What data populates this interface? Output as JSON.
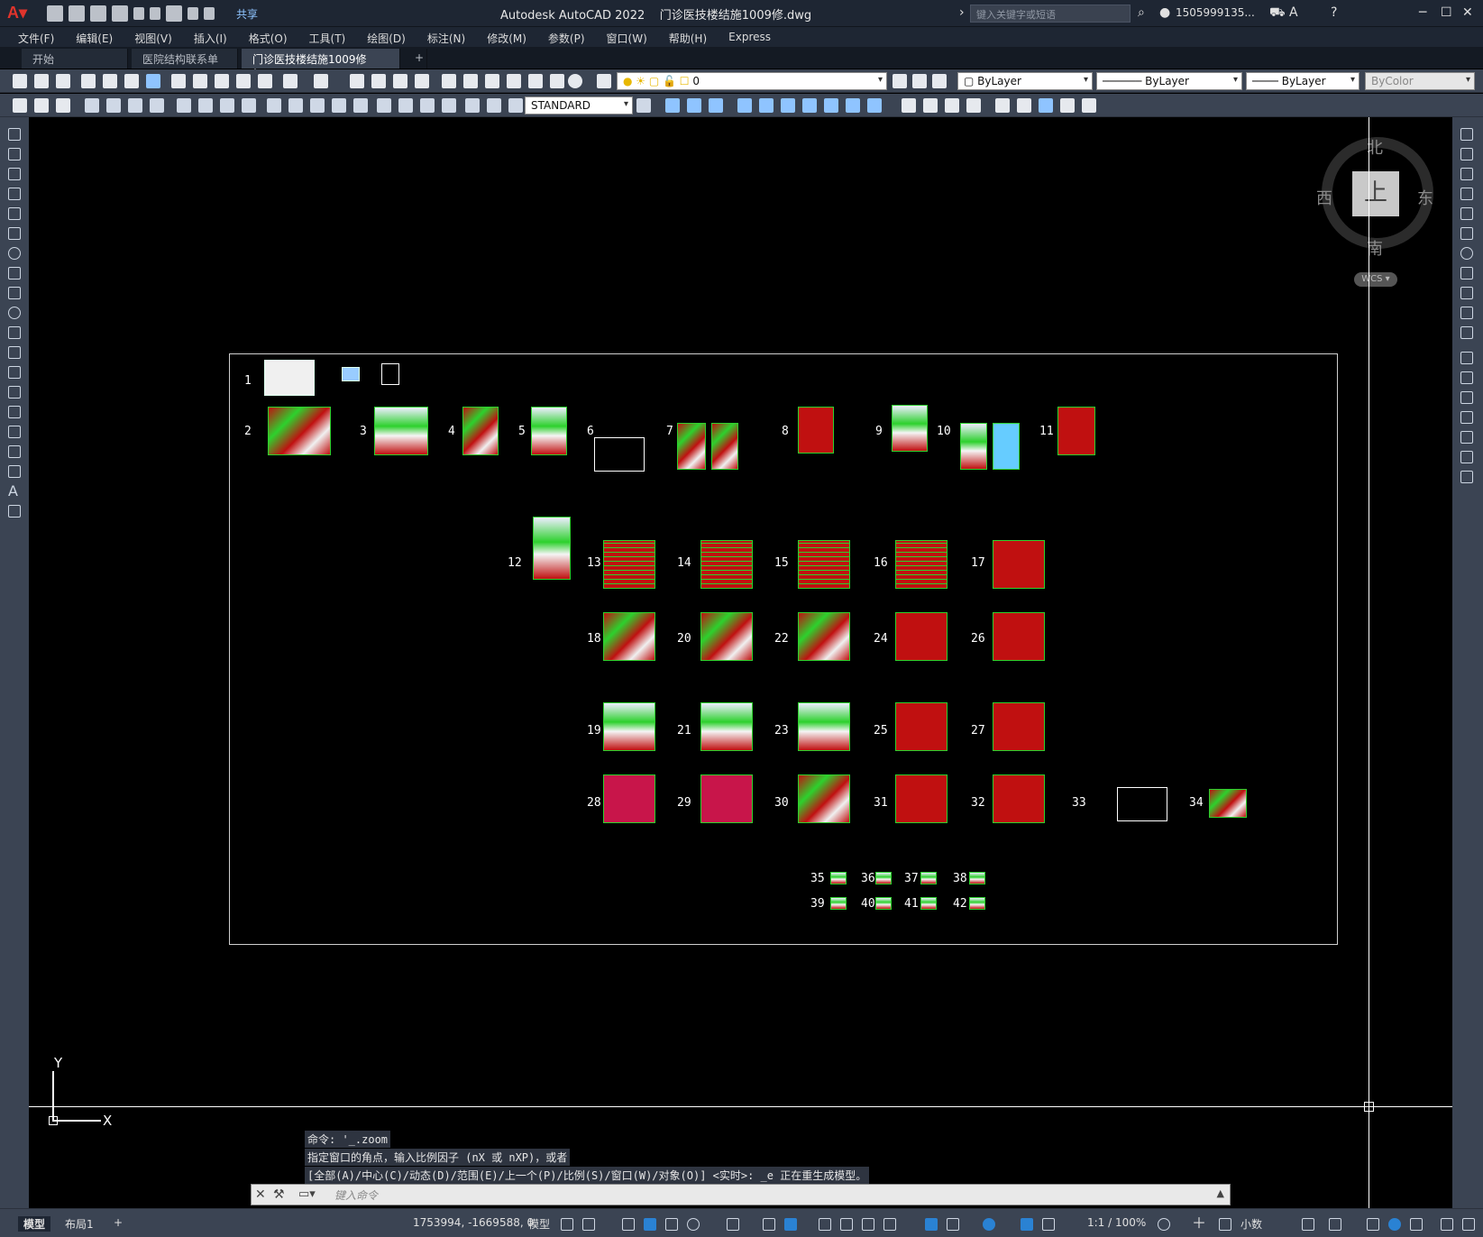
{
  "app": {
    "title": "Autodesk AutoCAD 2022    门诊医技楼结施1009修.dwg",
    "search_placeholder": "键入关键字或短语",
    "user": "1505999135...",
    "share_label": "共享"
  },
  "menu": [
    "文件(F)",
    "编辑(E)",
    "视图(V)",
    "插入(I)",
    "格式(O)",
    "工具(T)",
    "绘图(D)",
    "标注(N)",
    "修改(M)",
    "参数(P)",
    "窗口(W)",
    "帮助(H)",
    "Express"
  ],
  "tabs": [
    {
      "label": "开始"
    },
    {
      "label": "医院结构联系单"
    },
    {
      "label": "门诊医技楼结施1009修*"
    }
  ],
  "toolbar": {
    "layer_value": "0",
    "color_value": "ByLayer",
    "linetype_value": "ByLayer",
    "lineweight_value": "ByLayer",
    "plotstyle_value": "ByColor",
    "textstyle_value": "STANDARD"
  },
  "viewcube": {
    "north": "北",
    "south": "南",
    "east": "东",
    "west": "西",
    "face": "上",
    "wcs": "WCS"
  },
  "ucs": {
    "x": "X",
    "y": "Y"
  },
  "sheet_numbers": [
    "1",
    "2",
    "3",
    "4",
    "5",
    "6",
    "7",
    "8",
    "9",
    "10",
    "11",
    "12",
    "13",
    "14",
    "15",
    "16",
    "17",
    "18",
    "19",
    "20",
    "21",
    "22",
    "23",
    "24",
    "25",
    "26",
    "27",
    "28",
    "29",
    "30",
    "31",
    "32",
    "33",
    "34",
    "35",
    "36",
    "37",
    "38",
    "39",
    "40",
    "41",
    "42"
  ],
  "command": {
    "history": [
      "命令: '_.zoom",
      "指定窗口的角点，输入比例因子 (nX 或 nXP)，或者",
      "[全部(A)/中心(C)/动态(D)/范围(E)/上一个(P)/比例(S)/窗口(W)/对象(O)] <实时>: _e 正在重生成模型。"
    ],
    "placeholder": "键入命令"
  },
  "status": {
    "model_tab": "模型",
    "layout_tab": "布局1",
    "add_tab": "+",
    "coords": "1753994, -1669588, 0",
    "space": "模型",
    "scale": "1:1 / 100%",
    "units": "小数"
  },
  "colors": {
    "drawing_red": "#c01010",
    "drawing_green": "#2dd12d",
    "accent": "#2a82d3"
  }
}
